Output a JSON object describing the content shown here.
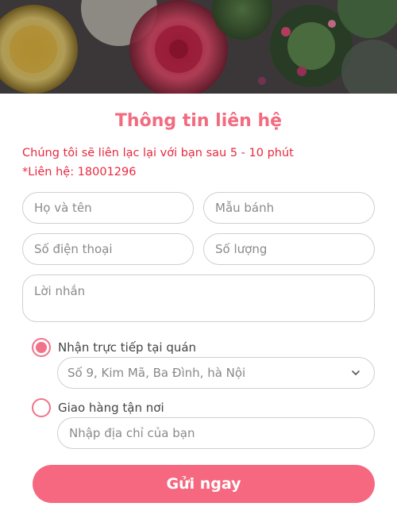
{
  "form": {
    "title": "Thông tin liên hệ",
    "note_line1": "Chúng tôi sẽ liên lạc lại với bạn sau 5 - 10 phút",
    "note_line2": "*Liên hệ: 18001296",
    "fields": {
      "name_placeholder": "Họ và tên",
      "model_placeholder": "Mẫu bánh",
      "phone_placeholder": "Số điện thoại",
      "quantity_placeholder": "Số lượng",
      "message_placeholder": "Lời nhắn"
    },
    "pickup": {
      "label": "Nhận trực tiếp tại quán",
      "selected": true,
      "store_selected": "Số 9, Kim Mã, Ba Đình, hà Nội"
    },
    "delivery": {
      "label": "Giao hàng tận nơi",
      "selected": false,
      "address_placeholder": "Nhập địa chỉ của bạn"
    },
    "submit_label": "Gửi ngay"
  },
  "colors": {
    "accent": "#f5687f",
    "note_red": "#e8293f"
  },
  "icons": {
    "select_arrow": "chevron-down-icon"
  }
}
